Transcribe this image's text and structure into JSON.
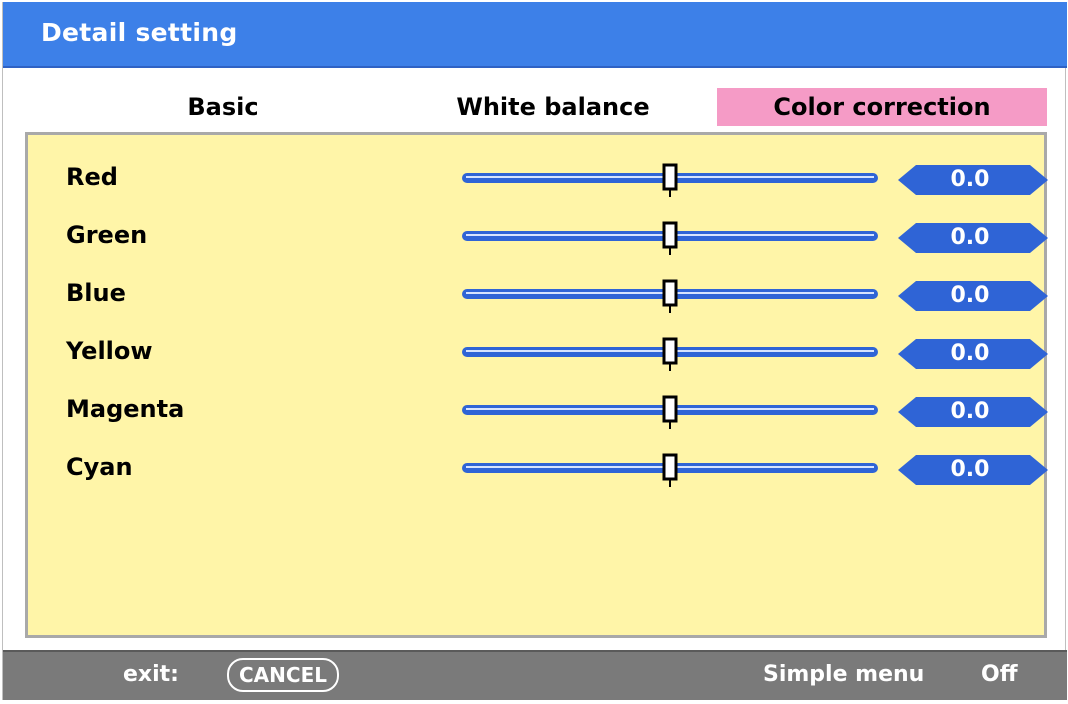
{
  "window": {
    "title": "Detail setting"
  },
  "tabs": [
    {
      "label": "Basic",
      "selected": false
    },
    {
      "label": "White balance",
      "selected": false
    },
    {
      "label": "Color correction",
      "selected": true
    }
  ],
  "settings": [
    {
      "label": "Red",
      "value": "0.0",
      "level": 0.5
    },
    {
      "label": "Green",
      "value": "0.0",
      "level": 0.5
    },
    {
      "label": "Blue",
      "value": "0.0",
      "level": 0.5
    },
    {
      "label": "Yellow",
      "value": "0.0",
      "level": 0.5
    },
    {
      "label": "Magenta",
      "value": "0.0",
      "level": 0.5
    },
    {
      "label": "Cyan",
      "value": "0.0",
      "level": 0.5
    }
  ],
  "footer": {
    "exit_label": "exit:",
    "cancel_label": "CANCEL",
    "simple_menu_label": "Simple menu",
    "simple_menu_value": "Off"
  },
  "colors": {
    "title_bar": "#3d80e8",
    "selected_tab": "#f59bc6",
    "panel_background": "#fff5a8",
    "slider_track": "#2f64d6",
    "footer": "#7a7a7a"
  }
}
